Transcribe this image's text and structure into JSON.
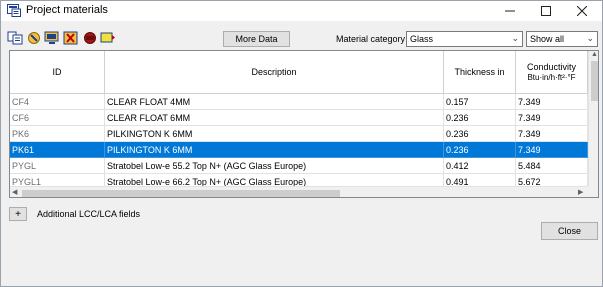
{
  "window": {
    "title": "Project materials",
    "controls": {
      "minimize": "—",
      "maximize": "☐",
      "close": "✕"
    }
  },
  "toolbar": {
    "icons": [
      "copy-icon",
      "library-icon",
      "monitor-icon",
      "delete-icon",
      "material-icon",
      "label-icon"
    ],
    "more_data_label": "More Data",
    "category_label": "Material category",
    "category_value": "Glass",
    "show_value": "Show all"
  },
  "grid": {
    "headers": {
      "id": "ID",
      "description": "Description",
      "thickness": "Thickness in",
      "conductivity": "Conductivity",
      "conductivity_unit": "Btu·in/h·ft²·°F"
    },
    "rows": [
      {
        "id": "CF4",
        "description": "CLEAR FLOAT 4MM",
        "thickness": "0.157",
        "conductivity": "7.349",
        "selected": false
      },
      {
        "id": "CF6",
        "description": "CLEAR FLOAT 6MM",
        "thickness": "0.236",
        "conductivity": "7.349",
        "selected": false
      },
      {
        "id": "PK6",
        "description": "PILKINGTON K 6MM",
        "thickness": "0.236",
        "conductivity": "7.349",
        "selected": false
      },
      {
        "id": "PK61",
        "description": "PILKINGTON K 6MM",
        "thickness": "0.236",
        "conductivity": "7.349",
        "selected": true
      },
      {
        "id": "PYGL",
        "description": "Stratobel Low-e 55.2 Top N+ (AGC Glass Europe)",
        "thickness": "0.412",
        "conductivity": "5.484",
        "selected": false
      },
      {
        "id": "PYGL1",
        "description": "Stratobel Low-e 66.2 Top N+ (AGC Glass Europe)",
        "thickness": "0.491",
        "conductivity": "5.672",
        "selected": false
      }
    ]
  },
  "bottom": {
    "plus_label": "+",
    "additional_label": "Additional LCC/LCA fields",
    "close_label": "Close"
  }
}
